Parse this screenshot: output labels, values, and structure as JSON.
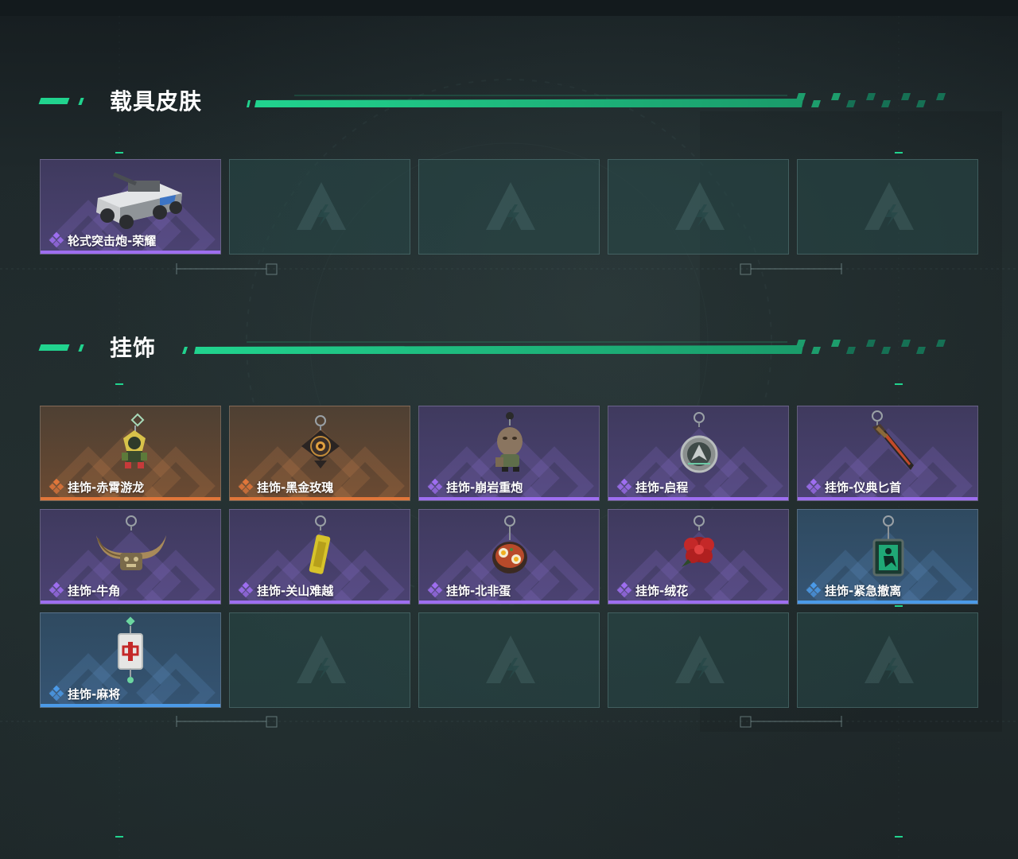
{
  "sections": [
    {
      "title": "载具皮肤"
    },
    {
      "title": "挂饰"
    }
  ],
  "colors": {
    "accent": "#21d38e",
    "rarity_purple": "#9e6ef0",
    "rarity_orange": "#e0763a",
    "rarity_blue": "#4b9ae8"
  },
  "vehicle_skins": [
    {
      "label": "轮式突击炮-荣耀",
      "rarity": "purple",
      "icon": "armored-vehicle-icon"
    },
    {
      "empty": true,
      "icon": "placeholder-logo-icon"
    },
    {
      "empty": true,
      "icon": "placeholder-logo-icon"
    },
    {
      "empty": true,
      "icon": "placeholder-logo-icon"
    },
    {
      "empty": true,
      "icon": "placeholder-logo-icon"
    }
  ],
  "charms": [
    {
      "label": "挂饰-赤霄游龙",
      "rarity": "orange",
      "icon": "dragon-figure-charm-icon"
    },
    {
      "label": "挂饰-黑金玫瑰",
      "rarity": "orange",
      "icon": "black-gold-rose-charm-icon"
    },
    {
      "label": "挂饰-崩岩重炮",
      "rarity": "purple",
      "icon": "rock-figure-charm-icon"
    },
    {
      "label": "挂饰-启程",
      "rarity": "purple",
      "icon": "round-medal-charm-icon"
    },
    {
      "label": "挂饰-仪典匕首",
      "rarity": "purple",
      "icon": "dagger-charm-icon"
    },
    {
      "label": "挂饰-牛角",
      "rarity": "purple",
      "icon": "bull-horn-charm-icon"
    },
    {
      "label": "挂饰-关山难越",
      "rarity": "purple",
      "icon": "yellow-tag-charm-icon"
    },
    {
      "label": "挂饰-北非蛋",
      "rarity": "purple",
      "icon": "shakshuka-bowl-charm-icon"
    },
    {
      "label": "挂饰-绒花",
      "rarity": "purple",
      "icon": "red-flower-charm-icon"
    },
    {
      "label": "挂饰-紧急撤离",
      "rarity": "blue",
      "icon": "green-sign-charm-icon"
    },
    {
      "label": "挂饰-麻将",
      "rarity": "blue",
      "icon": "mahjong-tile-charm-icon"
    },
    {
      "empty": true,
      "icon": "placeholder-logo-icon"
    },
    {
      "empty": true,
      "icon": "placeholder-logo-icon"
    },
    {
      "empty": true,
      "icon": "placeholder-logo-icon"
    },
    {
      "empty": true,
      "icon": "placeholder-logo-icon"
    }
  ]
}
